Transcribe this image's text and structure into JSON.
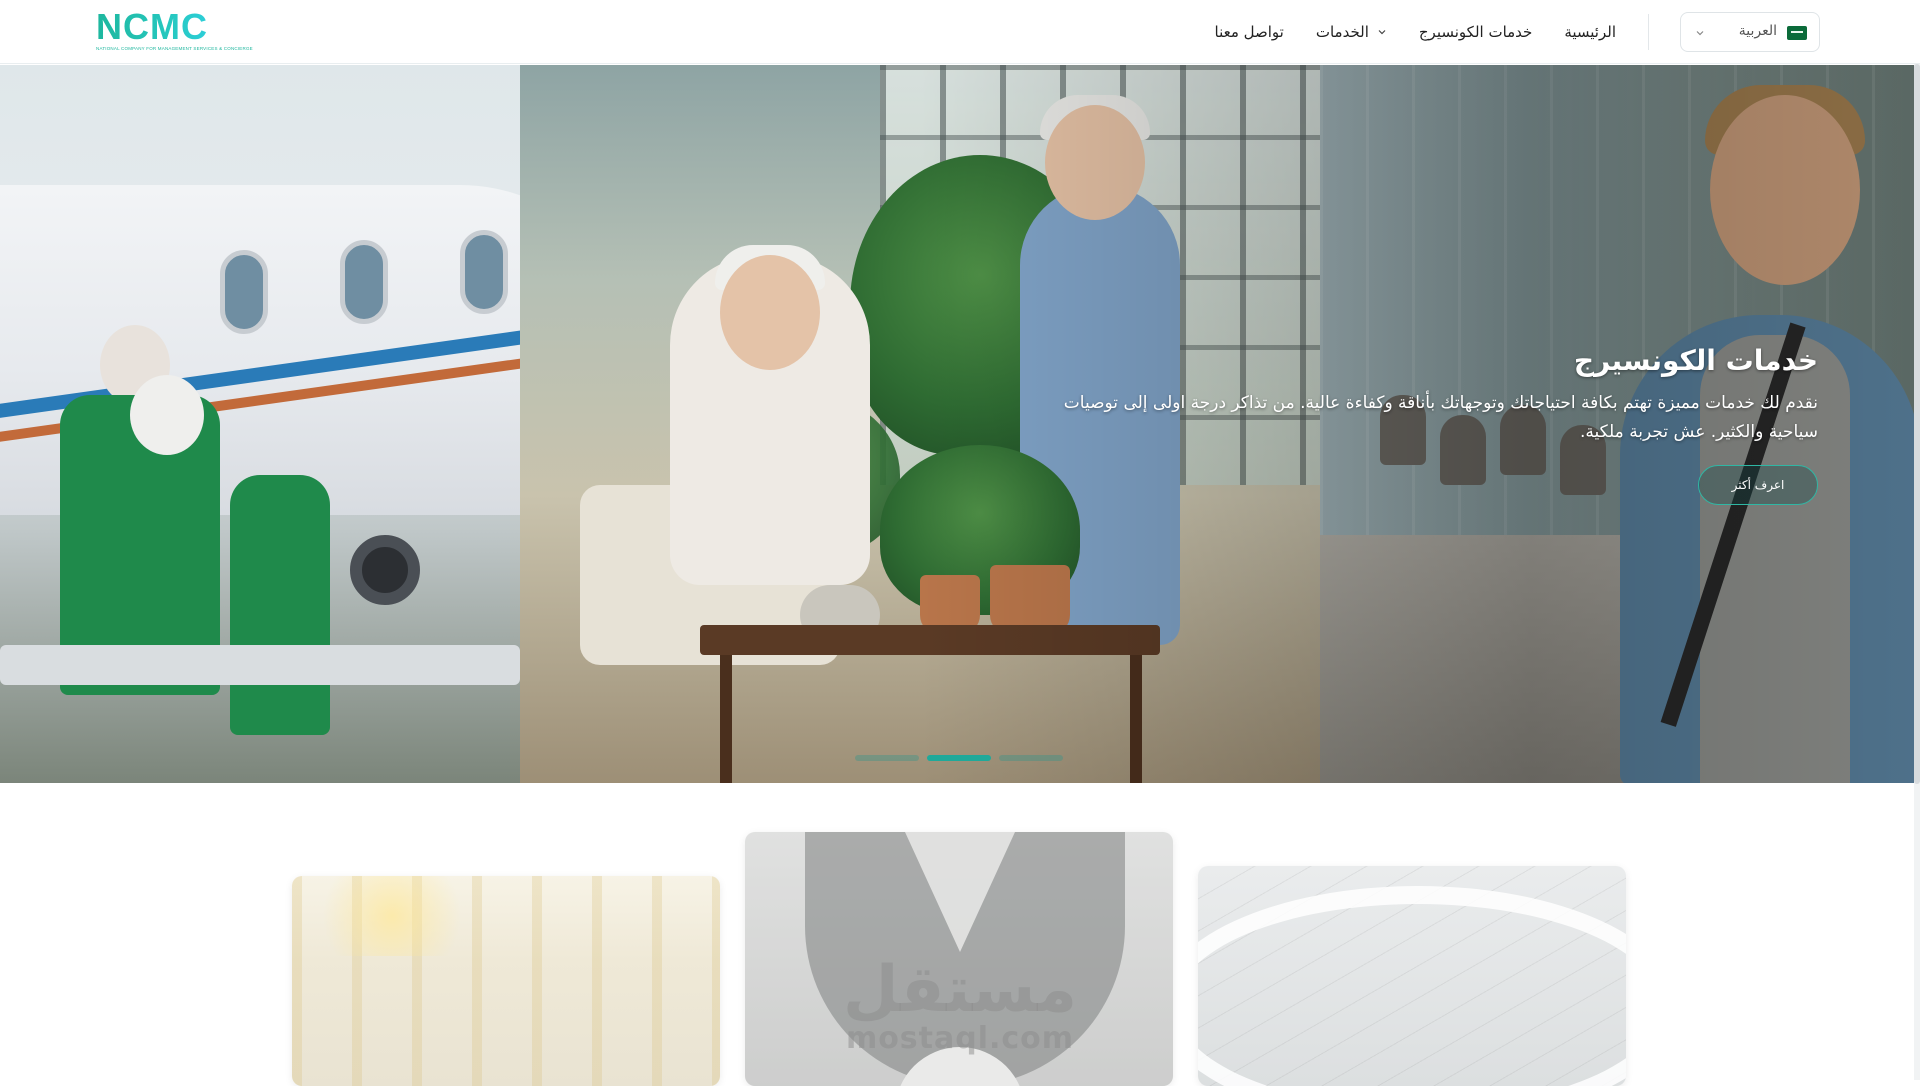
{
  "brand": {
    "logo_text": "NCMC",
    "logo_tagline": "NATIONAL COMPANY FOR MANAGEMENT SERVICES & CONCIERGE",
    "brand_color": "#1eb79e"
  },
  "nav": {
    "items": [
      {
        "label": "تواصل معنا"
      },
      {
        "label": "الخدمات",
        "has_dropdown": true
      },
      {
        "label": "خدمات الكونسيرج"
      },
      {
        "label": "الرئيسية"
      }
    ]
  },
  "language": {
    "selected": "العربية",
    "flag_icon": "saudi-flag-icon"
  },
  "hero": {
    "title": "خدمات الكونسيرج",
    "description": "نقدم لك خدمات مميزة تهتم بكافة احتياجاتك وتوجهاتك بأناقة وكفاءة عالية. من تذاكر درجة اولى إلى توصيات سياحية والكثير. عش تجربة ملكية.",
    "cta_label": "اعرف أكثر",
    "slides_count": 3,
    "active_slide": 2
  },
  "watermark": {
    "arabic": "مستقل",
    "latin": "mostaql.com"
  },
  "colors": {
    "accent": "#1fa99a",
    "cta_border": "#2fb7a4"
  }
}
